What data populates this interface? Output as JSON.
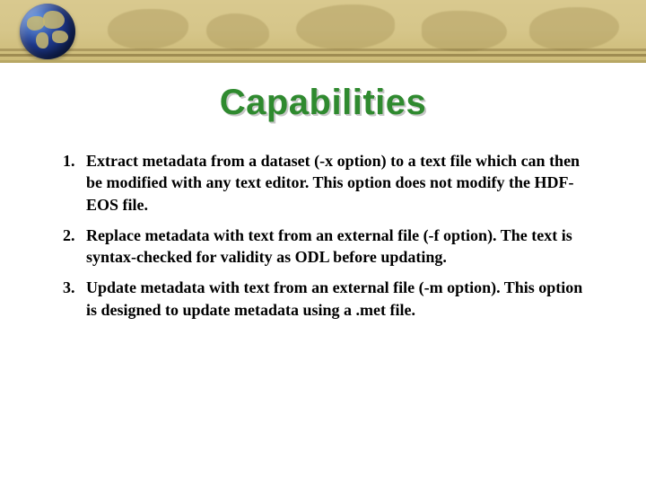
{
  "title": "Capabilities",
  "items": [
    {
      "num": "1.",
      "text": "Extract metadata from a dataset (-x option) to a text file which can then be modified with any text editor.  This option does not modify the HDF-EOS file."
    },
    {
      "num": "2.",
      "text": "Replace metadata with text from an external file (-f option).  The text is syntax-checked for validity as ODL before updating."
    },
    {
      "num": "3.",
      "text": "Update metadata with text from an external file (-m option). This option is designed to update metadata using a .met file."
    }
  ]
}
